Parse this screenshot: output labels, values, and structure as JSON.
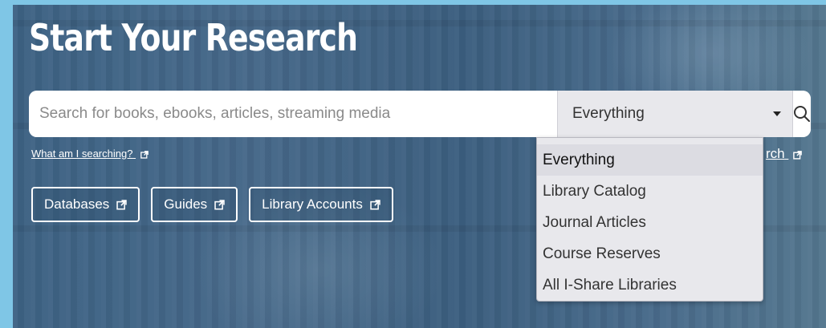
{
  "hero": {
    "title": "Start Your Research"
  },
  "search": {
    "placeholder": "Search for books, ebooks, articles, streaming media",
    "value": "",
    "scope_selected": "Everything",
    "button_icon": "search-icon"
  },
  "links": {
    "what_am_i_searching": "What am I searching?",
    "advanced_search_partial": "rch"
  },
  "nav_buttons": [
    {
      "label": "Databases",
      "icon": "external-link-icon"
    },
    {
      "label": "Guides",
      "icon": "external-link-icon"
    },
    {
      "label": "Library Accounts",
      "icon": "external-link-icon"
    }
  ],
  "dropdown": {
    "options": [
      {
        "label": "Everything",
        "selected": true
      },
      {
        "label": "Library Catalog",
        "selected": false
      },
      {
        "label": "Journal Articles",
        "selected": false
      },
      {
        "label": "Course Reserves",
        "selected": false
      },
      {
        "label": "All I-Share Libraries",
        "selected": false
      }
    ]
  },
  "colors": {
    "page_bg": "#7fc6e6",
    "hero_overlay": "#41678a",
    "text_light": "#ffffff",
    "dropdown_bg": "#e8e8ec"
  }
}
